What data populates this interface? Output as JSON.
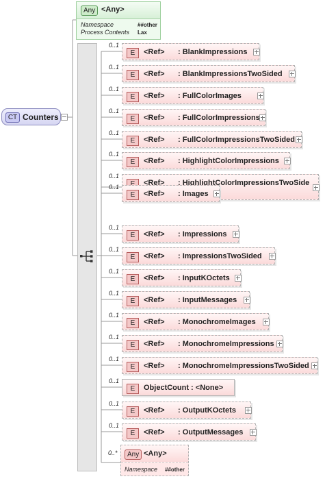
{
  "complex_type": {
    "badge": "CT",
    "name": "Counters"
  },
  "wildcard_top": {
    "badge": "Any",
    "title": "<Any>",
    "namespace_label": "Namespace",
    "namespace_value": "##other",
    "process_label": "Process Contents",
    "process_value": "Lax"
  },
  "rows": [
    {
      "occurs": "0..1",
      "badge": "E",
      "ref": "<Ref>",
      "name": ": BlankImpressions"
    },
    {
      "occurs": "0..1",
      "badge": "E",
      "ref": "<Ref>",
      "name": ": BlankImpressionsTwoSided"
    },
    {
      "occurs": "0..1",
      "badge": "E",
      "ref": "<Ref>",
      "name": ": FullColorImages"
    },
    {
      "occurs": "0..1",
      "badge": "E",
      "ref": "<Ref>",
      "name": ": FullColorImpressions"
    },
    {
      "occurs": "0..1",
      "badge": "E",
      "ref": "<Ref>",
      "name": ": FullColorImpressionsTwoSided"
    },
    {
      "occurs": "0..1",
      "badge": "E",
      "ref": "<Ref>",
      "name": ": HighlightColorImpressions"
    },
    {
      "occurs": "0..1",
      "badge": "E",
      "ref": "<Ref>",
      "name": ": HighlightColorImpressionsTwoSide",
      "name2": "d"
    },
    {
      "occurs": "0..1",
      "badge": "E",
      "ref": "<Ref>",
      "name": ": Images"
    },
    {
      "occurs": "0..1",
      "badge": "E",
      "ref": "<Ref>",
      "name": ": Impressions"
    },
    {
      "occurs": "0..1",
      "badge": "E",
      "ref": "<Ref>",
      "name": ": ImpressionsTwoSided"
    },
    {
      "occurs": "0..1",
      "badge": "E",
      "ref": "<Ref>",
      "name": ": InputKOctets"
    },
    {
      "occurs": "0..1",
      "badge": "E",
      "ref": "<Ref>",
      "name": ": InputMessages"
    },
    {
      "occurs": "0..1",
      "badge": "E",
      "ref": "<Ref>",
      "name": ": MonochromeImages"
    },
    {
      "occurs": "0..1",
      "badge": "E",
      "ref": "<Ref>",
      "name": ": MonochromeImpressions"
    },
    {
      "occurs": "0..1",
      "badge": "E",
      "ref": "<Ref>",
      "name": ": MonochromeImpressionsTwoSided"
    },
    {
      "occurs": "0..1",
      "badge": "E",
      "ref": "",
      "name": "ObjectCount : <None>"
    },
    {
      "occurs": "0..1",
      "badge": "E",
      "ref": "<Ref>",
      "name": ": OutputKOctets"
    },
    {
      "occurs": "0..1",
      "badge": "E",
      "ref": "<Ref>",
      "name": ": OutputMessages"
    }
  ],
  "wildcard_bottom": {
    "occurs": "0..*",
    "badge": "Any",
    "title": "<Any>",
    "namespace_label": "Namespace",
    "namespace_value": "##other"
  }
}
